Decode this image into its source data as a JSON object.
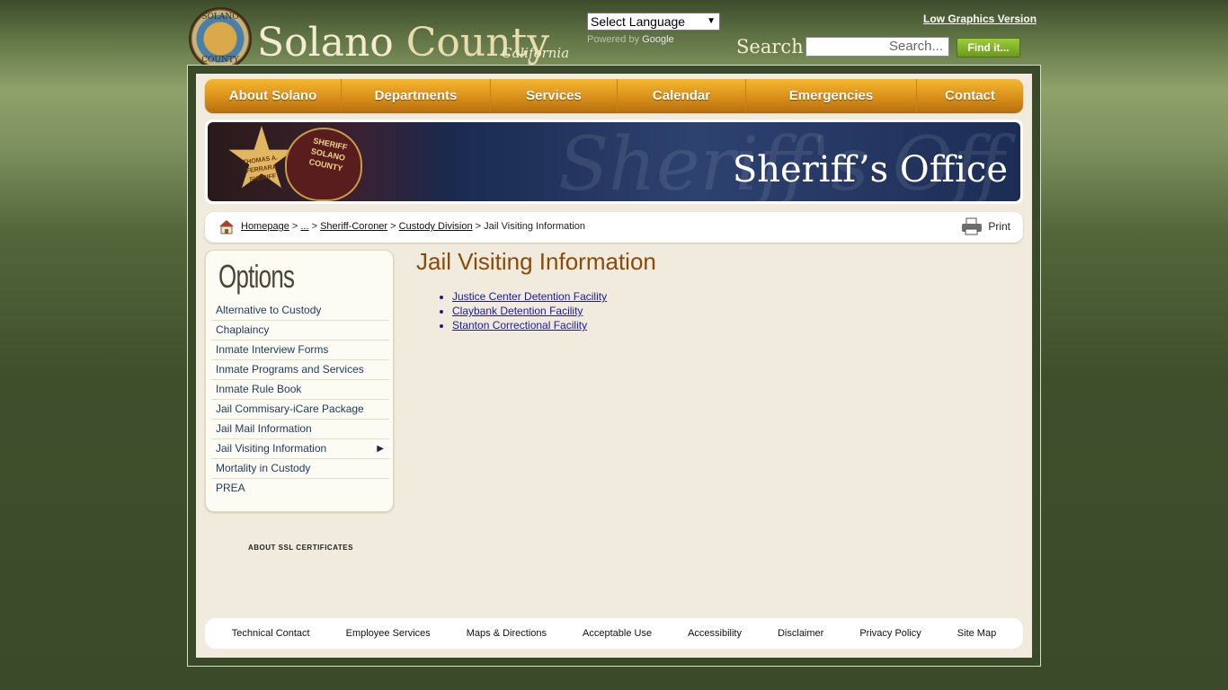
{
  "header": {
    "seal_top": "SOLANO",
    "seal_bottom": "COUNTY",
    "logo_word1": "Solano",
    "logo_word2": "County",
    "logo_sub": "California",
    "language_select": "Select Language",
    "powered_by": "Powered by",
    "powered_brand": "Google",
    "low_graphics": "Low Graphics Version",
    "search_label": "Search",
    "search_placeholder": "Search...",
    "find_button": "Find it..."
  },
  "nav": {
    "items": [
      {
        "label": "About Solano"
      },
      {
        "label": "Departments"
      },
      {
        "label": "Services"
      },
      {
        "label": "Calendar"
      },
      {
        "label": "Emergencies"
      },
      {
        "label": "Contact"
      }
    ]
  },
  "banner": {
    "badge1": "THOMAS A. FERRARA SHERIFF",
    "badge2": "SHERIFF SOLANO COUNTY",
    "script_text": "Sheriff's Off",
    "title": "Sheriff’s Office"
  },
  "breadcrumb": {
    "items": [
      "Homepage",
      "...",
      "Sheriff-Coroner",
      "Custody Division"
    ],
    "current": "Jail Visiting Information",
    "print": "Print"
  },
  "sidebar": {
    "title": "Options",
    "items": [
      {
        "label": "Alternative to Custody"
      },
      {
        "label": "Chaplaincy"
      },
      {
        "label": "Inmate Interview Forms"
      },
      {
        "label": "Inmate Programs and Services"
      },
      {
        "label": "Inmate Rule Book"
      },
      {
        "label": "Jail Commisary-iCare Package"
      },
      {
        "label": "Jail Mail Information"
      },
      {
        "label": "Jail Visiting Information",
        "active": true
      },
      {
        "label": "Mortality in Custody"
      },
      {
        "label": "PREA"
      }
    ],
    "ssl": "ABOUT SSL CERTIFICATES"
  },
  "main": {
    "title": "Jail Visiting Information",
    "links": [
      "Justice Center Detention Facility",
      "Claybank Detention Facility",
      "Stanton Correctional Facility"
    ]
  },
  "footer": {
    "links": [
      "Technical Contact",
      "Employee Services",
      "Maps & Directions",
      "Acceptable Use",
      "Accessibility",
      "Disclaimer",
      "Privacy Policy",
      "Site Map"
    ]
  },
  "colors": {
    "nav_gold": "#e39a1f",
    "title_brown": "#8a4b0a",
    "link_blue": "#1a1aa0",
    "page_bg": "#f0ebdc"
  }
}
